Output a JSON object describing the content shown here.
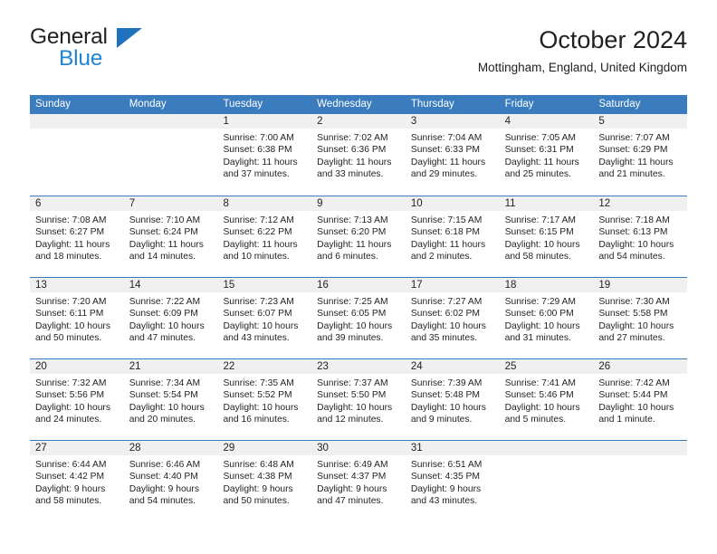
{
  "brand": {
    "word1": "General",
    "word2": "Blue",
    "triangle_color": "#1f72bd",
    "word2_color": "#1f86d4"
  },
  "header": {
    "title": "October 2024",
    "subtitle": "Mottingham, England, United Kingdom"
  },
  "theme": {
    "header_blue": "#3a7cbe",
    "date_band_gray": "#f0f0f0",
    "text_color": "#231f20"
  },
  "weekdays": [
    "Sunday",
    "Monday",
    "Tuesday",
    "Wednesday",
    "Thursday",
    "Friday",
    "Saturday"
  ],
  "weeks": [
    [
      {
        "day": "",
        "sunrise": "",
        "sunset": "",
        "daylight": "",
        "empty": true
      },
      {
        "day": "",
        "sunrise": "",
        "sunset": "",
        "daylight": "",
        "empty": true
      },
      {
        "day": "1",
        "sunrise": "Sunrise: 7:00 AM",
        "sunset": "Sunset: 6:38 PM",
        "daylight": "Daylight: 11 hours and 37 minutes."
      },
      {
        "day": "2",
        "sunrise": "Sunrise: 7:02 AM",
        "sunset": "Sunset: 6:36 PM",
        "daylight": "Daylight: 11 hours and 33 minutes."
      },
      {
        "day": "3",
        "sunrise": "Sunrise: 7:04 AM",
        "sunset": "Sunset: 6:33 PM",
        "daylight": "Daylight: 11 hours and 29 minutes."
      },
      {
        "day": "4",
        "sunrise": "Sunrise: 7:05 AM",
        "sunset": "Sunset: 6:31 PM",
        "daylight": "Daylight: 11 hours and 25 minutes."
      },
      {
        "day": "5",
        "sunrise": "Sunrise: 7:07 AM",
        "sunset": "Sunset: 6:29 PM",
        "daylight": "Daylight: 11 hours and 21 minutes."
      }
    ],
    [
      {
        "day": "6",
        "sunrise": "Sunrise: 7:08 AM",
        "sunset": "Sunset: 6:27 PM",
        "daylight": "Daylight: 11 hours and 18 minutes."
      },
      {
        "day": "7",
        "sunrise": "Sunrise: 7:10 AM",
        "sunset": "Sunset: 6:24 PM",
        "daylight": "Daylight: 11 hours and 14 minutes."
      },
      {
        "day": "8",
        "sunrise": "Sunrise: 7:12 AM",
        "sunset": "Sunset: 6:22 PM",
        "daylight": "Daylight: 11 hours and 10 minutes."
      },
      {
        "day": "9",
        "sunrise": "Sunrise: 7:13 AM",
        "sunset": "Sunset: 6:20 PM",
        "daylight": "Daylight: 11 hours and 6 minutes."
      },
      {
        "day": "10",
        "sunrise": "Sunrise: 7:15 AM",
        "sunset": "Sunset: 6:18 PM",
        "daylight": "Daylight: 11 hours and 2 minutes."
      },
      {
        "day": "11",
        "sunrise": "Sunrise: 7:17 AM",
        "sunset": "Sunset: 6:15 PM",
        "daylight": "Daylight: 10 hours and 58 minutes."
      },
      {
        "day": "12",
        "sunrise": "Sunrise: 7:18 AM",
        "sunset": "Sunset: 6:13 PM",
        "daylight": "Daylight: 10 hours and 54 minutes."
      }
    ],
    [
      {
        "day": "13",
        "sunrise": "Sunrise: 7:20 AM",
        "sunset": "Sunset: 6:11 PM",
        "daylight": "Daylight: 10 hours and 50 minutes."
      },
      {
        "day": "14",
        "sunrise": "Sunrise: 7:22 AM",
        "sunset": "Sunset: 6:09 PM",
        "daylight": "Daylight: 10 hours and 47 minutes."
      },
      {
        "day": "15",
        "sunrise": "Sunrise: 7:23 AM",
        "sunset": "Sunset: 6:07 PM",
        "daylight": "Daylight: 10 hours and 43 minutes."
      },
      {
        "day": "16",
        "sunrise": "Sunrise: 7:25 AM",
        "sunset": "Sunset: 6:05 PM",
        "daylight": "Daylight: 10 hours and 39 minutes."
      },
      {
        "day": "17",
        "sunrise": "Sunrise: 7:27 AM",
        "sunset": "Sunset: 6:02 PM",
        "daylight": "Daylight: 10 hours and 35 minutes."
      },
      {
        "day": "18",
        "sunrise": "Sunrise: 7:29 AM",
        "sunset": "Sunset: 6:00 PM",
        "daylight": "Daylight: 10 hours and 31 minutes."
      },
      {
        "day": "19",
        "sunrise": "Sunrise: 7:30 AM",
        "sunset": "Sunset: 5:58 PM",
        "daylight": "Daylight: 10 hours and 27 minutes."
      }
    ],
    [
      {
        "day": "20",
        "sunrise": "Sunrise: 7:32 AM",
        "sunset": "Sunset: 5:56 PM",
        "daylight": "Daylight: 10 hours and 24 minutes."
      },
      {
        "day": "21",
        "sunrise": "Sunrise: 7:34 AM",
        "sunset": "Sunset: 5:54 PM",
        "daylight": "Daylight: 10 hours and 20 minutes."
      },
      {
        "day": "22",
        "sunrise": "Sunrise: 7:35 AM",
        "sunset": "Sunset: 5:52 PM",
        "daylight": "Daylight: 10 hours and 16 minutes."
      },
      {
        "day": "23",
        "sunrise": "Sunrise: 7:37 AM",
        "sunset": "Sunset: 5:50 PM",
        "daylight": "Daylight: 10 hours and 12 minutes."
      },
      {
        "day": "24",
        "sunrise": "Sunrise: 7:39 AM",
        "sunset": "Sunset: 5:48 PM",
        "daylight": "Daylight: 10 hours and 9 minutes."
      },
      {
        "day": "25",
        "sunrise": "Sunrise: 7:41 AM",
        "sunset": "Sunset: 5:46 PM",
        "daylight": "Daylight: 10 hours and 5 minutes."
      },
      {
        "day": "26",
        "sunrise": "Sunrise: 7:42 AM",
        "sunset": "Sunset: 5:44 PM",
        "daylight": "Daylight: 10 hours and 1 minute."
      }
    ],
    [
      {
        "day": "27",
        "sunrise": "Sunrise: 6:44 AM",
        "sunset": "Sunset: 4:42 PM",
        "daylight": "Daylight: 9 hours and 58 minutes."
      },
      {
        "day": "28",
        "sunrise": "Sunrise: 6:46 AM",
        "sunset": "Sunset: 4:40 PM",
        "daylight": "Daylight: 9 hours and 54 minutes."
      },
      {
        "day": "29",
        "sunrise": "Sunrise: 6:48 AM",
        "sunset": "Sunset: 4:38 PM",
        "daylight": "Daylight: 9 hours and 50 minutes."
      },
      {
        "day": "30",
        "sunrise": "Sunrise: 6:49 AM",
        "sunset": "Sunset: 4:37 PM",
        "daylight": "Daylight: 9 hours and 47 minutes."
      },
      {
        "day": "31",
        "sunrise": "Sunrise: 6:51 AM",
        "sunset": "Sunset: 4:35 PM",
        "daylight": "Daylight: 9 hours and 43 minutes."
      },
      {
        "day": "",
        "sunrise": "",
        "sunset": "",
        "daylight": "",
        "empty": true
      },
      {
        "day": "",
        "sunrise": "",
        "sunset": "",
        "daylight": "",
        "empty": true
      }
    ]
  ]
}
